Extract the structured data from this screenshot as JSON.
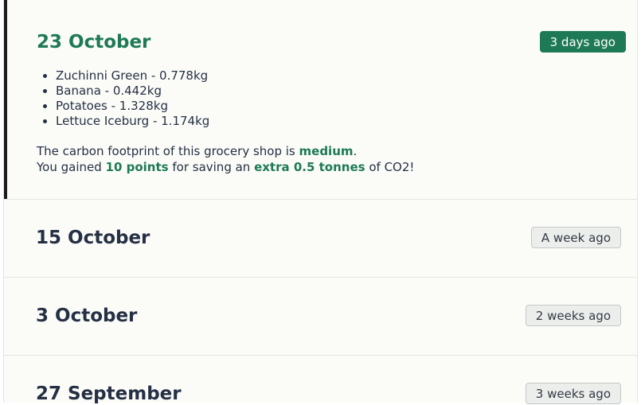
{
  "shops": [
    {
      "date": "23 October",
      "age": "3 days ago",
      "items": [
        "Zuchinni Green - 0.778kg",
        "Banana - 0.442kg",
        "Potatoes - 1.328kg",
        "Lettuce Iceburg - 1.174kg"
      ],
      "footprint_prefix": "The carbon footprint of this grocery shop is ",
      "footprint_level": "medium",
      "footprint_suffix": ".",
      "points_prefix": "You gained ",
      "points": "10 points",
      "points_middle": " for saving an ",
      "saving": "extra 0.5 tonnes",
      "points_suffix": " of CO2!"
    },
    {
      "date": "15 October",
      "age": "A week ago"
    },
    {
      "date": "3 October",
      "age": "2 weeks ago"
    },
    {
      "date": "27 September",
      "age": "3 weeks ago"
    }
  ],
  "colors": {
    "accent": "#1e7a56",
    "text": "#263044",
    "card_bg": "#fbfcf8",
    "active_border": "#1e1a1a"
  }
}
